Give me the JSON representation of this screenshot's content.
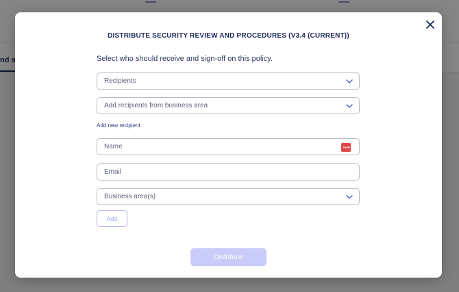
{
  "background": {
    "tab_label": "nd si"
  },
  "modal": {
    "title": "DISTRIBUTE SECURITY REVIEW AND PROCEDURES (V3.4 (CURRENT))",
    "instruction": "Select who should receive and sign-off on this policy.",
    "close_icon": "close-icon",
    "recipients_select": {
      "placeholder": "Recipients",
      "icon": "chevron-down-icon"
    },
    "business_area_recipients_select": {
      "placeholder": "Add recipients from business area",
      "icon": "chevron-down-icon"
    },
    "add_new_recipient_link": "Add new recipient",
    "name_field": {
      "placeholder": "Name",
      "icon": "password-manager-icon"
    },
    "email_field": {
      "placeholder": "Email"
    },
    "business_areas_select": {
      "placeholder": "Business area(s)",
      "icon": "chevron-down-icon"
    },
    "add_button": "Add",
    "distribute_button": "Distribute"
  },
  "colors": {
    "primary": "#1c2a5c",
    "chevron": "#5468c8",
    "disabled_button": "#c9ccf8",
    "disabled_outline": "#a8b0f0",
    "password_badge": "#e04848"
  }
}
